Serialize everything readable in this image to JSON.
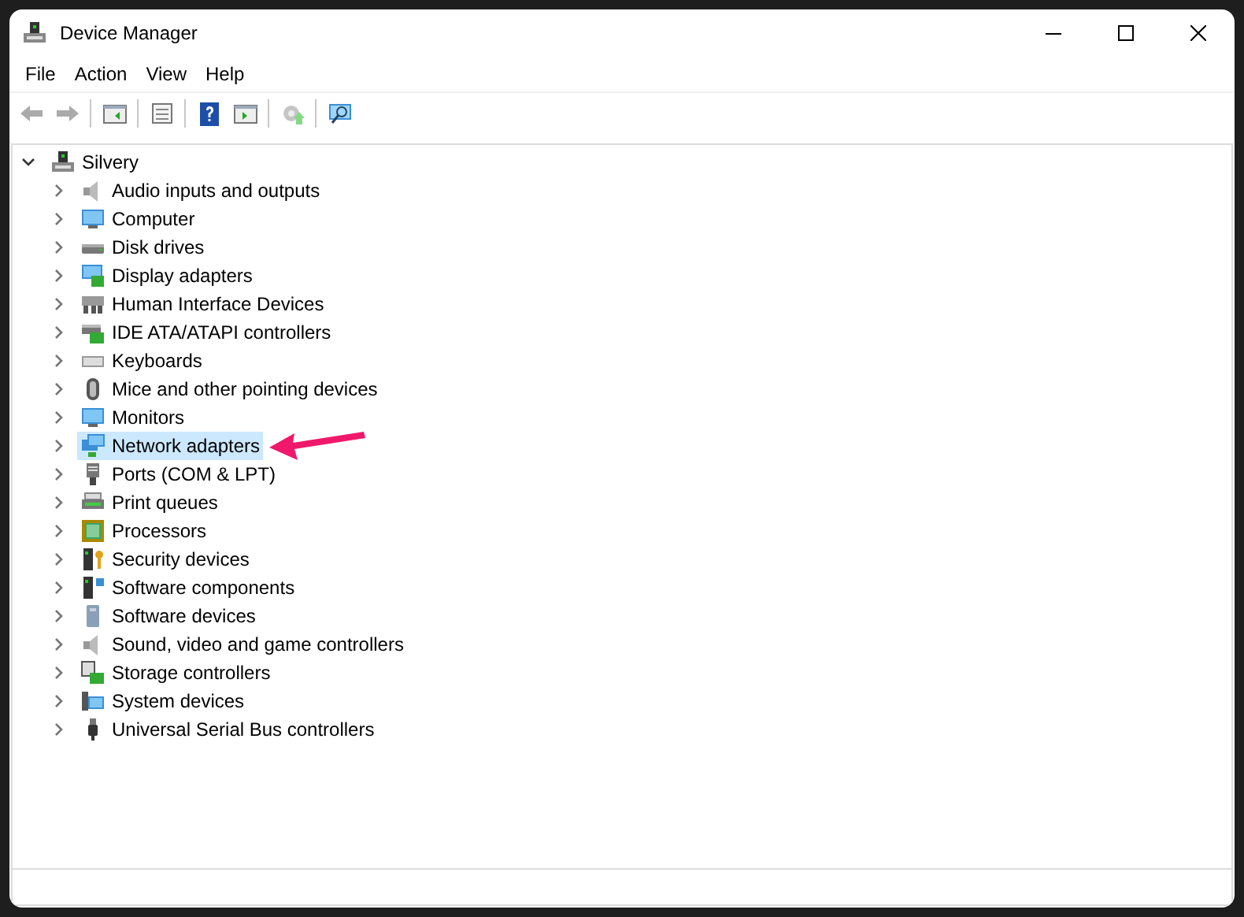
{
  "window": {
    "title": "Device Manager"
  },
  "menu": [
    "File",
    "Action",
    "View",
    "Help"
  ],
  "toolbar": [
    [
      {
        "kind": "back",
        "disabled": true
      },
      {
        "kind": "forward",
        "disabled": true
      }
    ],
    [
      {
        "kind": "panel",
        "disabled": false
      }
    ],
    [
      {
        "kind": "properties",
        "disabled": false
      }
    ],
    [
      {
        "kind": "help",
        "disabled": false
      },
      {
        "kind": "run",
        "disabled": false
      }
    ],
    [
      {
        "kind": "update",
        "disabled": true
      }
    ],
    [
      {
        "kind": "scan",
        "disabled": false
      }
    ]
  ],
  "tree": {
    "label": "Silvery",
    "kind": "computer",
    "expanded": true,
    "children": [
      {
        "label": "Audio inputs and outputs",
        "kind": "speaker",
        "expanded": false,
        "selected": false
      },
      {
        "label": "Computer",
        "kind": "monitor",
        "expanded": false,
        "selected": false
      },
      {
        "label": "Disk drives",
        "kind": "disk",
        "expanded": false,
        "selected": false
      },
      {
        "label": "Display adapters",
        "kind": "card",
        "expanded": false,
        "selected": false
      },
      {
        "label": "Human Interface Devices",
        "kind": "hid",
        "expanded": false,
        "selected": false
      },
      {
        "label": "IDE ATA/ATAPI controllers",
        "kind": "ide",
        "expanded": false,
        "selected": false
      },
      {
        "label": "Keyboards",
        "kind": "keyboard",
        "expanded": false,
        "selected": false
      },
      {
        "label": "Mice and other pointing devices",
        "kind": "mouse",
        "expanded": false,
        "selected": false
      },
      {
        "label": "Monitors",
        "kind": "monitor",
        "expanded": false,
        "selected": false
      },
      {
        "label": "Network adapters",
        "kind": "network",
        "expanded": false,
        "selected": true
      },
      {
        "label": "Ports (COM & LPT)",
        "kind": "port",
        "expanded": false,
        "selected": false
      },
      {
        "label": "Print queues",
        "kind": "printer",
        "expanded": false,
        "selected": false
      },
      {
        "label": "Processors",
        "kind": "chip",
        "expanded": false,
        "selected": false
      },
      {
        "label": "Security devices",
        "kind": "security",
        "expanded": false,
        "selected": false
      },
      {
        "label": "Software components",
        "kind": "component",
        "expanded": false,
        "selected": false
      },
      {
        "label": "Software devices",
        "kind": "tower",
        "expanded": false,
        "selected": false
      },
      {
        "label": "Sound, video and game controllers",
        "kind": "speaker",
        "expanded": false,
        "selected": false
      },
      {
        "label": "Storage controllers",
        "kind": "storage",
        "expanded": false,
        "selected": false
      },
      {
        "label": "System devices",
        "kind": "system",
        "expanded": false,
        "selected": false
      },
      {
        "label": "Universal Serial Bus controllers",
        "kind": "usb",
        "expanded": false,
        "selected": false
      }
    ]
  }
}
